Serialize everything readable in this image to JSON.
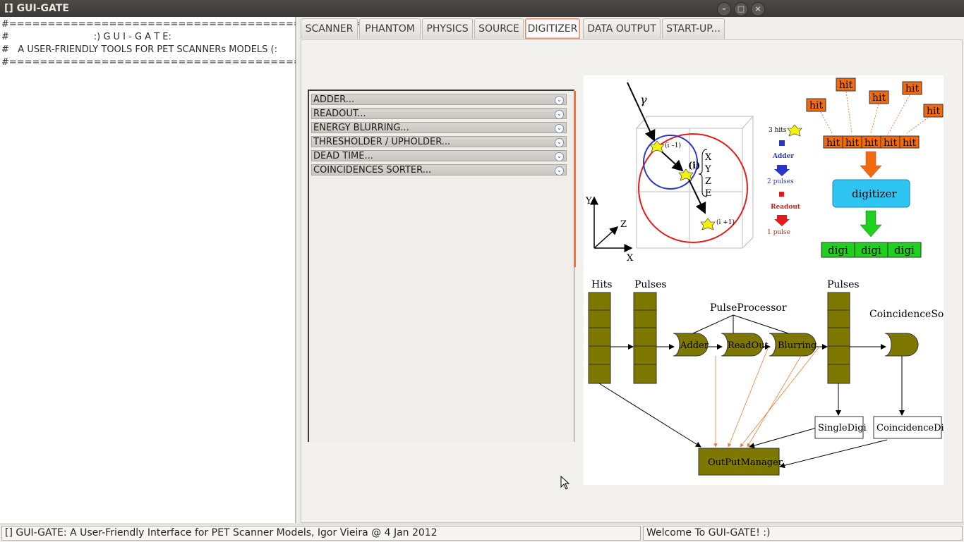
{
  "window": {
    "title": "[] GUI-GATE"
  },
  "console": {
    "lines": [
      "#================================================#",
      "#                             :) G U I - G A T E:",
      "#   A USER-FRIENDLY TOOLS FOR PET SCANNERs MODELS (:",
      "#================================================#"
    ]
  },
  "tabs": [
    {
      "label": "SCANNER",
      "active": false
    },
    {
      "label": "PHANTOM",
      "active": false
    },
    {
      "label": "PHYSICS",
      "active": false
    },
    {
      "label": "SOURCE",
      "active": false
    },
    {
      "label": "DIGITIZER",
      "active": true
    },
    {
      "label": "DATA OUTPUT",
      "active": false
    },
    {
      "label": "START-UP...",
      "active": false
    }
  ],
  "toolbox": {
    "items": [
      "ADDER...",
      "READOUT...",
      "ENERGY BLURRING...",
      "THRESHOLDER / UPHOLDER...",
      "DEAD TIME...",
      "COINCIDENCES SORTER..."
    ]
  },
  "diagram": {
    "gamma": "γ",
    "axes": {
      "x": "X",
      "y": "Y",
      "z": "Z"
    },
    "interaction_labels": [
      "(i –1)",
      "(i)",
      "(i +1)"
    ],
    "coords": [
      "X",
      "Y",
      "Z",
      "E"
    ],
    "coord_sub": "i",
    "legend": {
      "hits": "3 hits",
      "adder": "Adder",
      "pulses": "2 pulses",
      "readout": "Readout",
      "pulse": "1 pulse"
    },
    "hit": "hit",
    "digitizer": "digitizer",
    "digi": "digi",
    "flow": {
      "hits": "Hits",
      "pulses1": "Pulses",
      "pulses2": "Pulses",
      "processor": "PulseProcessor",
      "adder": "Adder",
      "readout": "ReadOut",
      "blurring": "Blurring",
      "coincidence_sorter": "CoincidenceSorter",
      "single_digi": "SingleDigi",
      "coincidence_digi": "CoincidenceDigi",
      "output_manager": "OutPutManager"
    },
    "colors": {
      "hit": "#f26a10",
      "digitizer": "#2ec5f2",
      "digi": "#1fd11f",
      "module": "#7f7800",
      "red": "#e31b1b",
      "blue": "#2a35c7"
    }
  },
  "status": {
    "left": "[] GUI-GATE: A User-Friendly Interface for PET Scanner Models, Igor Vieira @ 4 Jan 2012",
    "right": "Welcome To GUI-GATE! :)"
  }
}
